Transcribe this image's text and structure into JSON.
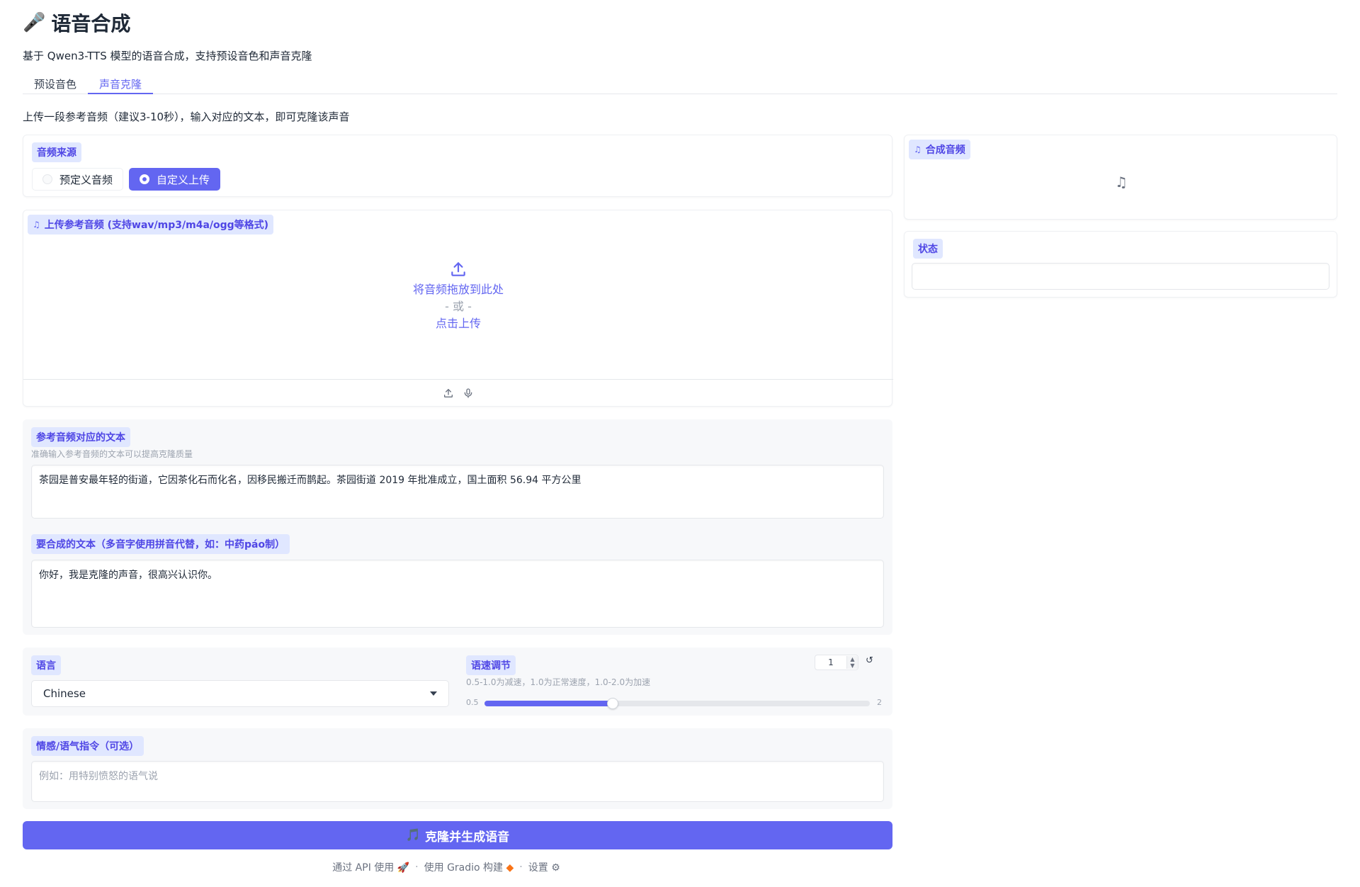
{
  "header": {
    "title_icon": "🎤",
    "title": "语音合成",
    "subtitle": "基于 Qwen3-TTS 模型的语音合成，支持预设音色和声音克隆"
  },
  "tabs": [
    {
      "label": "预设音色",
      "active": false
    },
    {
      "label": "声音克隆",
      "active": true
    }
  ],
  "description": "上传一段参考音频（建议3-10秒），输入对应的文本，即可克隆该声音",
  "audio_source": {
    "label": "音频来源",
    "options": [
      "预定义音频",
      "自定义上传"
    ],
    "selected": "自定义上传"
  },
  "upload": {
    "label": "上传参考音频 (支持wav/mp3/m4a/ogg等格式)",
    "drop_text": "将音频拖放到此处",
    "or_text": "- 或 -",
    "click_text": "点击上传"
  },
  "ref_text": {
    "label": "参考音频对应的文本",
    "info": "准确输入参考音频的文本可以提高克隆质量",
    "value": "茶园是普安最年轻的街道，它因茶化石而化名，因移民搬迁而鹊起。茶园街道 2019 年批准成立，国土面积 56.94 平方公里"
  },
  "synth_text": {
    "label": "要合成的文本（多音字使用拼音代替，如：中药páo制）",
    "value": "你好，我是克隆的声音，很高兴认识你。"
  },
  "language": {
    "label": "语言",
    "value": "Chinese"
  },
  "speed": {
    "label": "语速调节",
    "info": "0.5-1.0为减速，1.0为正常速度，1.0-2.0为加速",
    "value": "1",
    "min_label": "0.5",
    "max_label": "2",
    "min": 0.5,
    "max": 2,
    "current": 1
  },
  "instruction": {
    "label": "情感/语气指令（可选）",
    "placeholder": "例如：用特别愤怒的语气说"
  },
  "submit": {
    "icon": "🎵",
    "label": "克隆并生成语音"
  },
  "output_audio": {
    "label": "合成音频"
  },
  "status": {
    "label": "状态",
    "value": ""
  },
  "footer": {
    "api": "通过 API 使用",
    "built": "使用 Gradio 构建",
    "settings": "设置",
    "sep": "·"
  },
  "colors": {
    "accent": "#6366f1",
    "chip_bg": "#e0e7ff",
    "chip_text": "#4f46e5"
  }
}
